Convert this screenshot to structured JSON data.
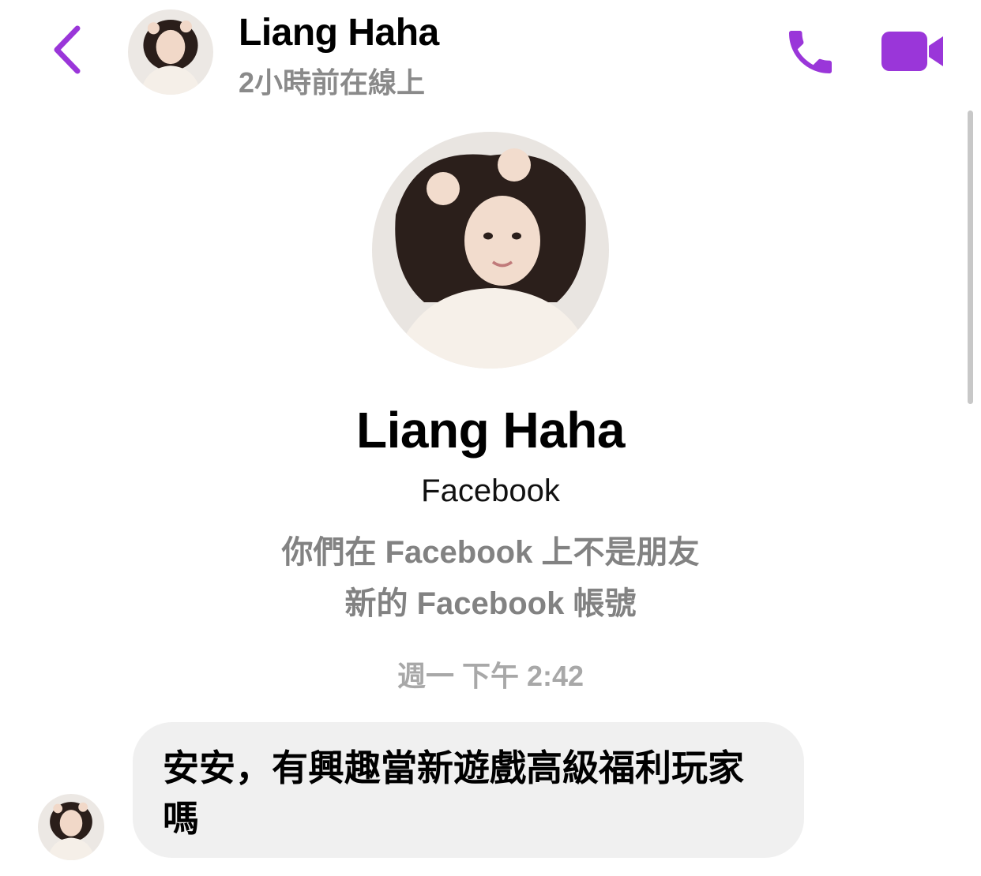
{
  "header": {
    "name": "Liang Haha",
    "status": "2小時前在線上",
    "icons": {
      "back": "chevron-left-icon",
      "call": "phone-icon",
      "video": "video-camera-icon"
    }
  },
  "profile": {
    "name": "Liang Haha",
    "platform": "Facebook",
    "relationship": "你們在 Facebook 上不是朋友",
    "account_note": "新的 Facebook 帳號"
  },
  "conversation": {
    "timestamp": "週一 下午 2:42",
    "messages": [
      {
        "sender": "Liang Haha",
        "text": "安安，有興趣當新遊戲高級福利玩家嗎"
      }
    ]
  },
  "colors": {
    "accent": "#9a36d9",
    "muted": "#828282",
    "bubble": "#f0f0f0"
  }
}
